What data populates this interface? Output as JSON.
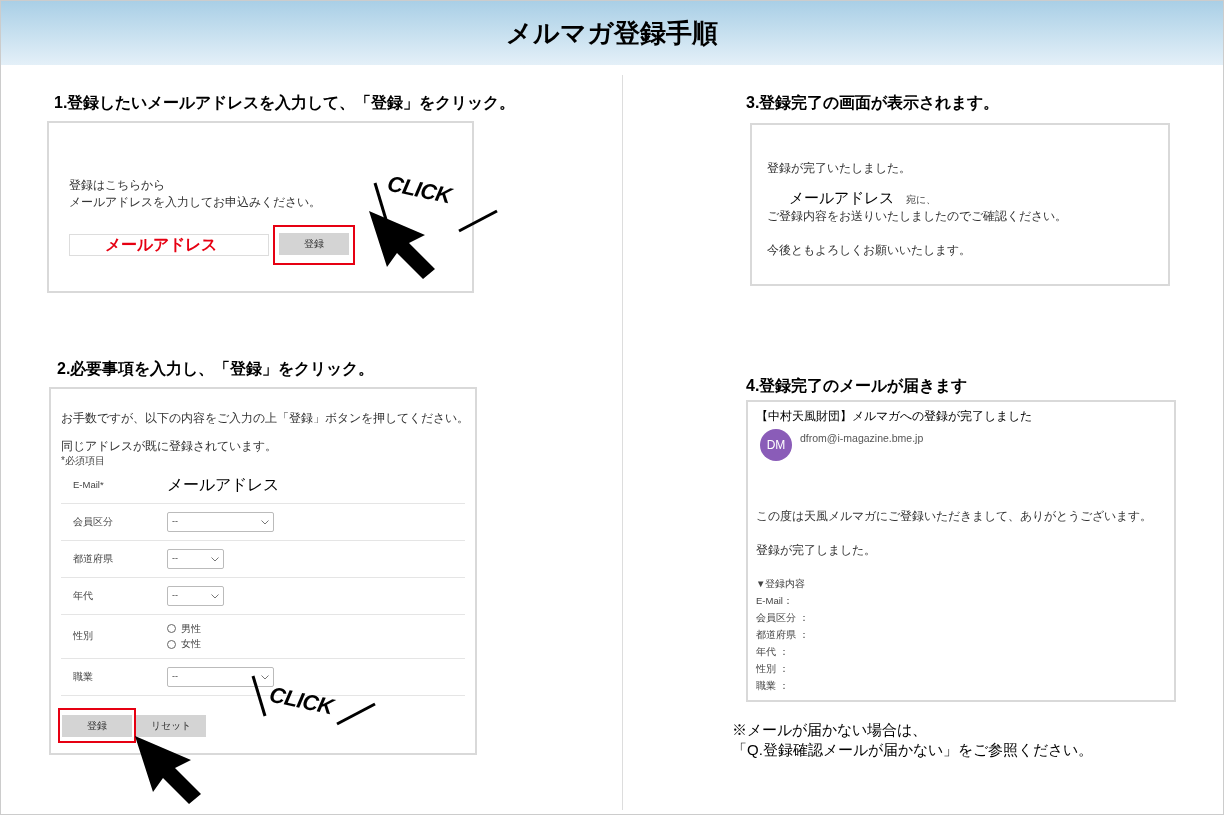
{
  "title": "メルマガ登録手順",
  "steps": [
    {
      "kind": "email_entry",
      "heading": "1.登録したいメールアドレスを入力して、「登録」をクリック。",
      "lines": [
        "登録はこちらから",
        "メールアドレスを入力してお申込みください。"
      ],
      "email_field": "メールアドレス",
      "submit": "登録",
      "callout": "CLICK"
    },
    {
      "kind": "form",
      "heading": "2.必要事項を入力し、「登録」をクリック。",
      "intro": "お手数ですが、以下の内容をご入力の上「登録」ボタンを押してください。",
      "notice": "同じアドレスが既に登録されています。",
      "required_note": "*必須項目",
      "fields": [
        {
          "kind": "text",
          "label": "E-Mail*",
          "value": "メールアドレス"
        },
        {
          "kind": "select",
          "label": "会員区分",
          "value": "--",
          "wide": true
        },
        {
          "kind": "select",
          "label": "都道府県",
          "value": "--",
          "wide": false
        },
        {
          "kind": "select",
          "label": "年代",
          "value": "--",
          "wide": false
        },
        {
          "kind": "radio",
          "label": "性別",
          "options": [
            {
              "label": "男性",
              "selected": false
            },
            {
              "label": "女性",
              "selected": false
            }
          ]
        },
        {
          "kind": "select",
          "label": "職業",
          "value": "--",
          "wide": true
        }
      ],
      "buttons": [
        {
          "label": "登録",
          "highlighted": true
        },
        {
          "label": "リセット",
          "highlighted": false
        }
      ],
      "callout": "CLICK"
    },
    {
      "kind": "complete",
      "heading": "3.登録完了の画面が表示されます。",
      "line1": "登録が完了いたしました。",
      "email": "メールアドレス",
      "email_suffix": "宛に、",
      "line2": "ご登録内容をお送りいたしましたのでご確認ください。",
      "line3": "今後ともよろしくお願いいたします。"
    },
    {
      "kind": "mail",
      "heading": "4.登録完了のメールが届きます",
      "subject": "【中村天風財団】メルマガへの登録が完了しました",
      "avatar": "DM",
      "sender": "dfrom@i-magazine.bme.jp",
      "body": [
        "この度は天風メルマガにご登録いただきまして、ありがとうございます。",
        "登録が完了しました。"
      ],
      "summary_title": "▼登録内容",
      "summary": [
        "E-Mail：",
        "会員区分 ：",
        "都道府県 ：",
        "年代 ：",
        "性別 ：",
        "職業 ："
      ]
    }
  ],
  "footnote": [
    "※メールが届かない場合は、",
    "「Q.登録確認メールが届かない」をご参照ください。"
  ]
}
